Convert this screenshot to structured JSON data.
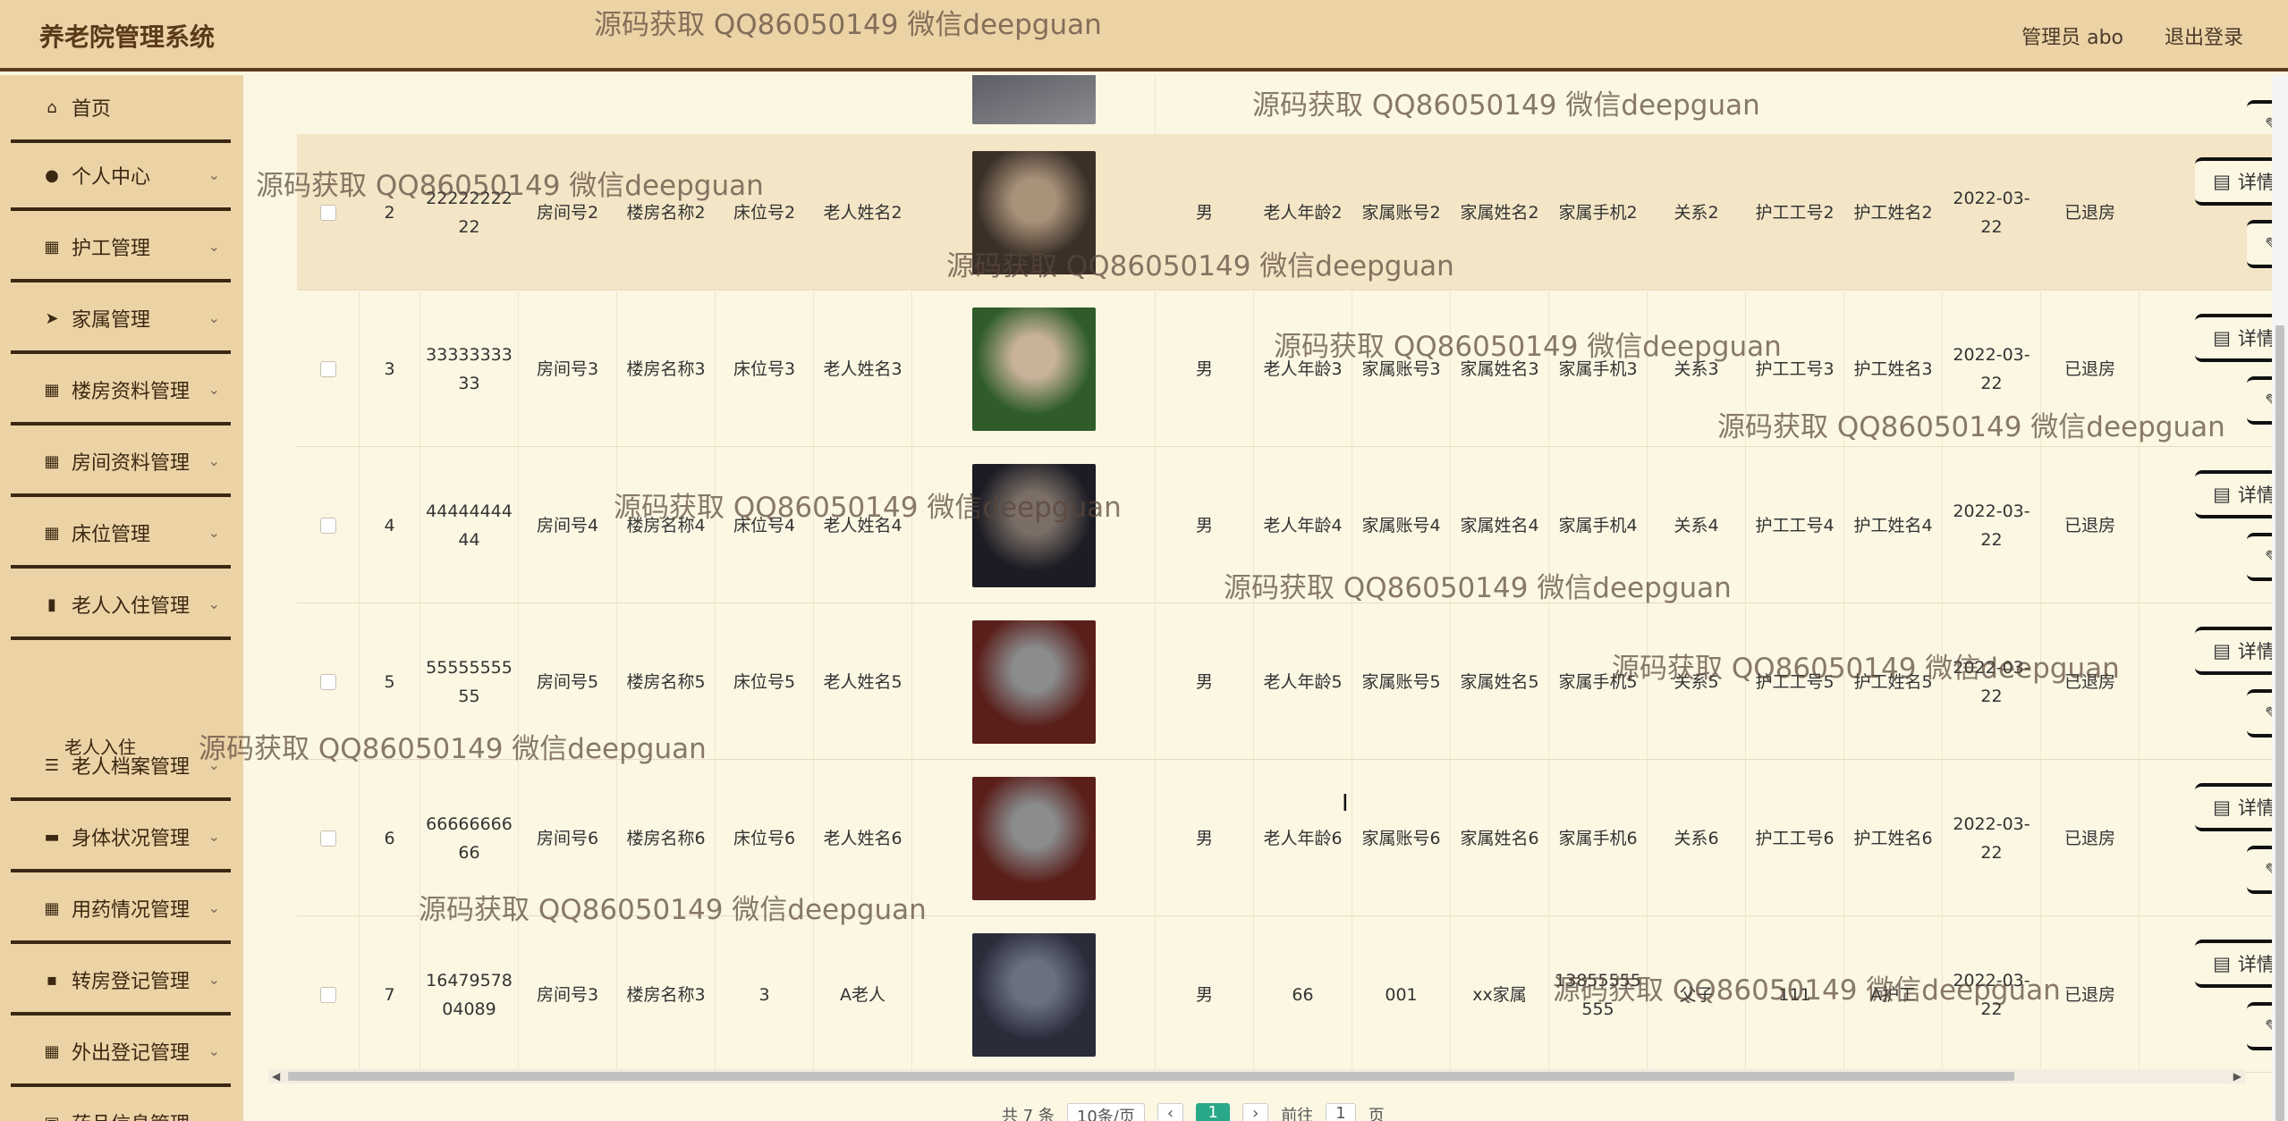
{
  "header": {
    "title": "养老院管理系统",
    "user": "管理员 abo",
    "logout": "退出登录"
  },
  "sidebar": {
    "items": [
      {
        "label": "首页",
        "icon": "home-icon",
        "glyph": "⌂"
      },
      {
        "label": "个人中心",
        "icon": "user-icon",
        "glyph": "●"
      },
      {
        "label": "护工管理",
        "icon": "grid-icon",
        "glyph": "▦"
      },
      {
        "label": "家属管理",
        "icon": "send-icon",
        "glyph": "➤"
      },
      {
        "label": "楼房资料管理",
        "icon": "grid-icon",
        "glyph": "▦"
      },
      {
        "label": "房间资料管理",
        "icon": "grid-icon",
        "glyph": "▦"
      },
      {
        "label": "床位管理",
        "icon": "grid-icon",
        "glyph": "▦"
      },
      {
        "label": "老人入住管理",
        "icon": "chart-icon",
        "glyph": "▮"
      },
      {
        "label": "老人档案管理",
        "icon": "list-icon",
        "glyph": "☰"
      },
      {
        "label": "身体状况管理",
        "icon": "monitor-icon",
        "glyph": "▬"
      },
      {
        "label": "用药情况管理",
        "icon": "grid-icon",
        "glyph": "▦"
      },
      {
        "label": "转房登记管理",
        "icon": "comment-icon",
        "glyph": "▪"
      },
      {
        "label": "外出登记管理",
        "icon": "grid-icon",
        "glyph": "▦"
      },
      {
        "label": "药品信息管理",
        "icon": "clipboard-icon",
        "glyph": "▣"
      }
    ],
    "sub_item": "老人入住"
  },
  "table": {
    "rows": [
      {
        "idx": "2",
        "account": "2222222222",
        "room": "房间号2",
        "building": "楼房名称2",
        "bed": "床位号2",
        "name": "老人姓名2",
        "gender": "男",
        "age": "老人年龄2",
        "fam_acc": "家属账号2",
        "fam_name": "家属姓名2",
        "fam_phone": "家属手机2",
        "relation": "关系2",
        "nurse_no": "护工工号2",
        "nurse_name": "护工姓名2",
        "date": "2022-03-22",
        "status": "已退房"
      },
      {
        "idx": "3",
        "account": "3333333333",
        "room": "房间号3",
        "building": "楼房名称3",
        "bed": "床位号3",
        "name": "老人姓名3",
        "gender": "男",
        "age": "老人年龄3",
        "fam_acc": "家属账号3",
        "fam_name": "家属姓名3",
        "fam_phone": "家属手机3",
        "relation": "关系3",
        "nurse_no": "护工工号3",
        "nurse_name": "护工姓名3",
        "date": "2022-03-22",
        "status": "已退房"
      },
      {
        "idx": "4",
        "account": "4444444444",
        "room": "房间号4",
        "building": "楼房名称4",
        "bed": "床位号4",
        "name": "老人姓名4",
        "gender": "男",
        "age": "老人年龄4",
        "fam_acc": "家属账号4",
        "fam_name": "家属姓名4",
        "fam_phone": "家属手机4",
        "relation": "关系4",
        "nurse_no": "护工工号4",
        "nurse_name": "护工姓名4",
        "date": "2022-03-22",
        "status": "已退房"
      },
      {
        "idx": "5",
        "account": "5555555555",
        "room": "房间号5",
        "building": "楼房名称5",
        "bed": "床位号5",
        "name": "老人姓名5",
        "gender": "男",
        "age": "老人年龄5",
        "fam_acc": "家属账号5",
        "fam_name": "家属姓名5",
        "fam_phone": "家属手机5",
        "relation": "关系5",
        "nurse_no": "护工工号5",
        "nurse_name": "护工姓名5",
        "date": "2022-03-22",
        "status": "已退房"
      },
      {
        "idx": "6",
        "account": "6666666666",
        "room": "房间号6",
        "building": "楼房名称6",
        "bed": "床位号6",
        "name": "老人姓名6",
        "gender": "男",
        "age": "老人年龄6",
        "fam_acc": "家属账号6",
        "fam_name": "家属姓名6",
        "fam_phone": "家属手机6",
        "relation": "关系6",
        "nurse_no": "护工工号6",
        "nurse_name": "护工姓名6",
        "date": "2022-03-22",
        "status": "已退房"
      },
      {
        "idx": "7",
        "account": "1647957804089",
        "room": "房间号3",
        "building": "楼房名称3",
        "bed": "3",
        "name": "A老人",
        "gender": "男",
        "age": "66",
        "fam_acc": "001",
        "fam_name": "xx家属",
        "fam_phone": "13855555555",
        "relation": "父子",
        "nurse_no": "111",
        "nurse_name": "A护工",
        "date": "2022-03-22",
        "status": "已退房"
      }
    ],
    "detail_label": "详情",
    "edit_label": "修改"
  },
  "pager": {
    "total": "共 7 条",
    "size": "10条/页",
    "page": "1",
    "goto": "前往",
    "goto_value": "1",
    "unit": "页"
  },
  "watermark": "源码获取 QQ86050149 微信deepguan"
}
